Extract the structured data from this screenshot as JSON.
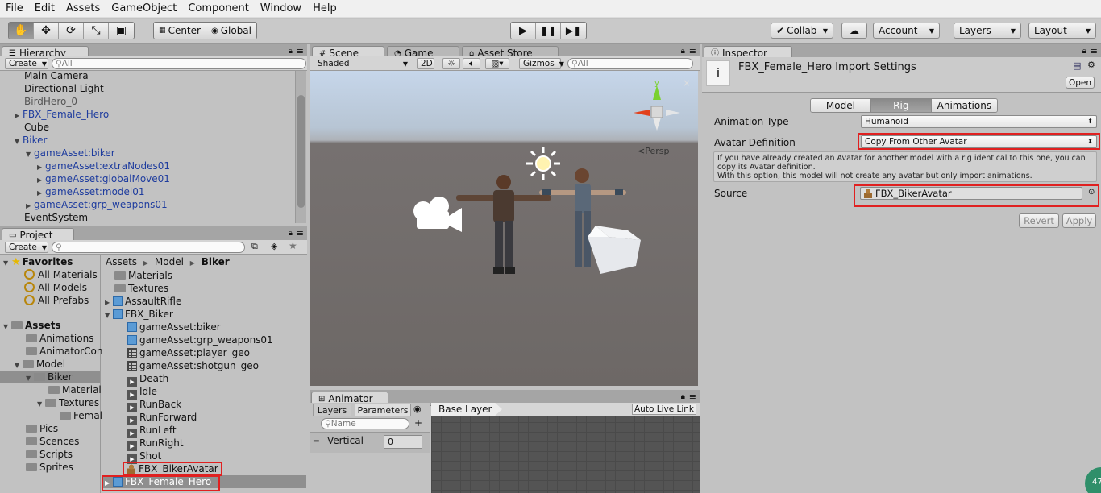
{
  "menu": [
    "File",
    "Edit",
    "Assets",
    "GameObject",
    "Component",
    "Window",
    "Help"
  ],
  "toolbar": {
    "pivot": "Center",
    "space": "Global",
    "collab": "Collab",
    "account": "Account",
    "layers": "Layers",
    "layout": "Layout"
  },
  "hierarchy": {
    "title": "Hierarchy",
    "create": "Create",
    "search_placeholder": "All",
    "items": [
      {
        "label": "Main Camera"
      },
      {
        "label": "Directional Light"
      },
      {
        "label": "BirdHero_0"
      },
      {
        "label": "FBX_Female_Hero"
      },
      {
        "label": "Cube"
      },
      {
        "label": "Biker"
      },
      {
        "label": "gameAsset:biker"
      },
      {
        "label": "gameAsset:extraNodes01"
      },
      {
        "label": "gameAsset:globalMove01"
      },
      {
        "label": "gameAsset:model01"
      },
      {
        "label": "gameAsset:grp_weapons01"
      },
      {
        "label": "EventSystem"
      }
    ]
  },
  "project": {
    "title": "Project",
    "create": "Create",
    "favorites": {
      "label": "Favorites",
      "items": [
        "All Materials",
        "All Models",
        "All Prefabs"
      ]
    },
    "assets": {
      "label": "Assets",
      "items": [
        "Animations",
        "AnimatorCon",
        "Model",
        "Biker",
        "Materials",
        "Textures",
        "Femal",
        "Pics",
        "Scences",
        "Scripts",
        "Sprites"
      ]
    },
    "breadcrumb": [
      "Assets",
      "Model",
      "Biker"
    ],
    "files": [
      "Materials",
      "Textures",
      "AssaultRifle",
      "FBX_Biker",
      "gameAsset:biker",
      "gameAsset:grp_weapons01",
      "gameAsset:player_geo",
      "gameAsset:shotgun_geo",
      "Death",
      "Idle",
      "RunBack",
      "RunForward",
      "RunLeft",
      "RunRight",
      "Shot",
      "FBX_BikerAvatar",
      "FBX_Female_Hero"
    ]
  },
  "scene": {
    "tabs": [
      "Scene",
      "Game",
      "Asset Store"
    ],
    "shading": "Shaded",
    "mode2d": "2D",
    "gizmos": "Gizmos",
    "search_placeholder": "All",
    "persp": "Persp",
    "gizmo_y": "y"
  },
  "animator": {
    "title": "Animator",
    "tab_layers": "Layers",
    "tab_parameters": "Parameters",
    "name_placeholder": "Name",
    "base_layer": "Base Layer",
    "auto_live": "Auto Live Link",
    "param_name": "Vertical",
    "param_value": "0"
  },
  "inspector": {
    "title": "Inspector",
    "header": "FBX_Female_Hero Import Settings",
    "open": "Open",
    "tabs": [
      "Model",
      "Rig",
      "Animations"
    ],
    "animation_type_label": "Animation Type",
    "animation_type_value": "Humanoid",
    "avatar_def_label": "Avatar Definition",
    "avatar_def_value": "Copy From Other Avatar",
    "help_line1": "If you have already created an Avatar for another model with a rig identical to this one, you can copy its Avatar definition.",
    "help_line2": "With this option, this model will not create any avatar but only import animations.",
    "source_label": "Source",
    "source_value": "FBX_BikerAvatar",
    "revert": "Revert",
    "apply": "Apply"
  },
  "badge": "47",
  "colors": {
    "accent_red": "#e02020",
    "selection": "#3d78c8",
    "hierarchy_blue": "#1e3c9e"
  }
}
